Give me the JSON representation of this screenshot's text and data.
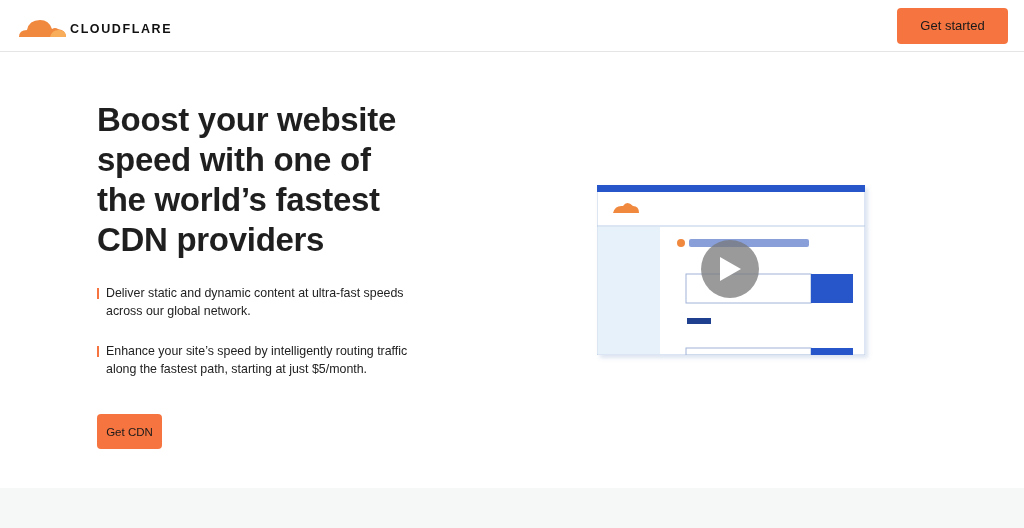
{
  "header": {
    "logo_text": "CLOUDFLARE",
    "cta": "Get started"
  },
  "hero": {
    "headline_lines": [
      "Boost your website",
      "speed with one of",
      "the world’s fastest",
      "CDN providers"
    ],
    "bullets": [
      {
        "lines": [
          "Deliver static and dynamic content at ultra-fast speeds",
          "across our global network."
        ]
      },
      {
        "lines": [
          "Enhance your site’s speed by intelligently routing traffic",
          "along the fastest path, starting at just $5/month."
        ]
      }
    ],
    "button": "Get CDN"
  }
}
